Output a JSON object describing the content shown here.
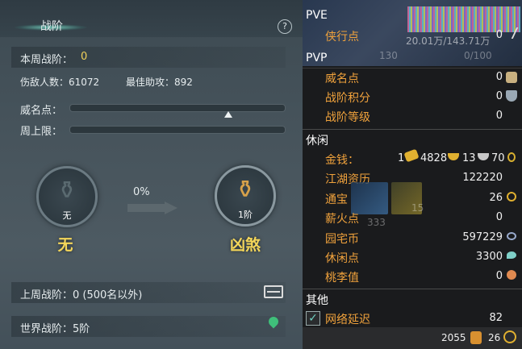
{
  "left": {
    "title": "战阶",
    "help": "?",
    "weekly_label": "本周战阶：",
    "weekly_value": "0",
    "kills_label": "伤敌人数：61072",
    "assist_label": "最佳助攻：892",
    "prestige_label": "威名点：",
    "prestige_progress": 0.74,
    "weekly_cap_label": "周上限：",
    "weekly_cap_progress": 0,
    "current_rank": {
      "caption": "无",
      "name": "无"
    },
    "progress_pct": "0%",
    "next_rank": {
      "caption": "1阶",
      "name": "凶煞"
    },
    "last_week": "上周战阶：0 (500名以外)",
    "world_rank": "世界战阶：5阶"
  },
  "right": {
    "pve": {
      "title": "PVE",
      "xiaxing_label": "侠行点",
      "xiaxing_value": "0",
      "bg_text_1": "20.01万/143.71万",
      "bg_text_2": "130",
      "bg_text_3": "0/100"
    },
    "pvp": {
      "title": "PVP",
      "items": [
        {
          "label": "威名点",
          "value": "0"
        },
        {
          "label": "战阶积分",
          "value": "0"
        },
        {
          "label": "战阶等级",
          "value": "0"
        }
      ]
    },
    "leisure": {
      "title": "休闲",
      "money_label": "金钱：",
      "money_gold_count": "1",
      "money_a": "4828",
      "money_b": "13",
      "money_c": "70",
      "items": [
        {
          "label": "江湖资历",
          "value": "122220"
        },
        {
          "label": "通宝",
          "value": "26"
        },
        {
          "label": "薪火点",
          "value": "0"
        },
        {
          "label": "园宅币",
          "value": "597229"
        },
        {
          "label": "休闲点",
          "value": "3300"
        },
        {
          "label": "桃李值",
          "value": "0"
        }
      ],
      "bg_num_1": "333",
      "bg_num_2": "15"
    },
    "other": {
      "title": "其他",
      "latency_label": "网络延迟",
      "latency_value": "82"
    },
    "footer": {
      "value_a": "2055",
      "value_b": "26"
    }
  },
  "colors": {
    "label_orange": "#f0a23c",
    "gold": "#f4d65a",
    "panel_dark": "#1a1b1d"
  }
}
